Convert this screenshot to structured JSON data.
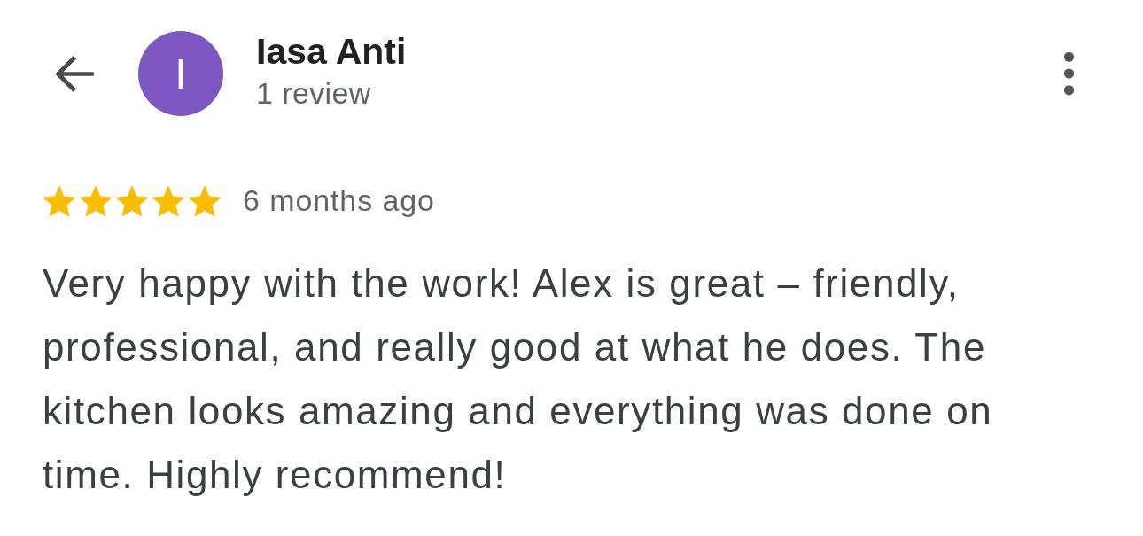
{
  "header": {
    "avatar_letter": "I",
    "name": "Iasa Anti",
    "review_count": "1 review"
  },
  "review": {
    "stars": 5,
    "time": "6 months ago",
    "text": "Very happy with the work! Alex is great – friendly, professional, and really good at what he does. The kitchen looks amazing and everything was done on time. Highly recommend!"
  }
}
